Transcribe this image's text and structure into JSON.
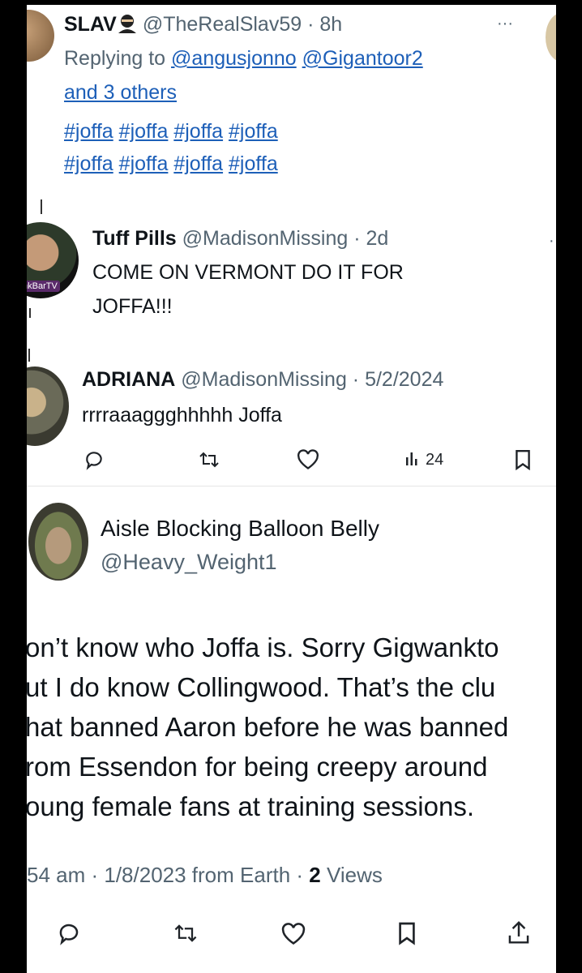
{
  "tweet1": {
    "name": "SLAV",
    "handle": "@TheRealSlav59",
    "time": "8h",
    "replying_prefix": "Replying to ",
    "mention1": "@angusjonno",
    "mention2": "@Gigantoor2",
    "and_others": "and 3 others",
    "hashtag": "#joffa",
    "more": "···"
  },
  "tweet2": {
    "name": "Tuff Pills",
    "handle": "@MadisonMissing",
    "time": "2d",
    "text_line1": "COME ON VERMONT DO IT FOR",
    "text_line2": "JOFFA!!!",
    "avatar_badge": "nkBarTV"
  },
  "tweet3": {
    "name": "ADRIANA",
    "handle": "@MadisonMissing",
    "time": "5/2/2024",
    "text": "rrrraaaggghhhhh Joffa",
    "views": "24"
  },
  "tweet4": {
    "name": "Aisle Blocking Balloon Belly",
    "handle": "@Heavy_Weight1",
    "lines": [
      "on’t know who Joffa is. Sorry Gigwankto",
      "ut I do know Collingwood. That’s the clu",
      "hat banned Aaron before he was banned",
      "rom Essendon for being creepy around",
      "oung female fans at training sessions."
    ],
    "meta_time": "54 am · 1/8/2023 from Earth · ",
    "views_count": "2",
    "views_label": " Views"
  },
  "icons": [
    "reply-icon",
    "retweet-icon",
    "like-icon",
    "views-icon",
    "bookmark-icon",
    "share-icon",
    "more-icon"
  ]
}
